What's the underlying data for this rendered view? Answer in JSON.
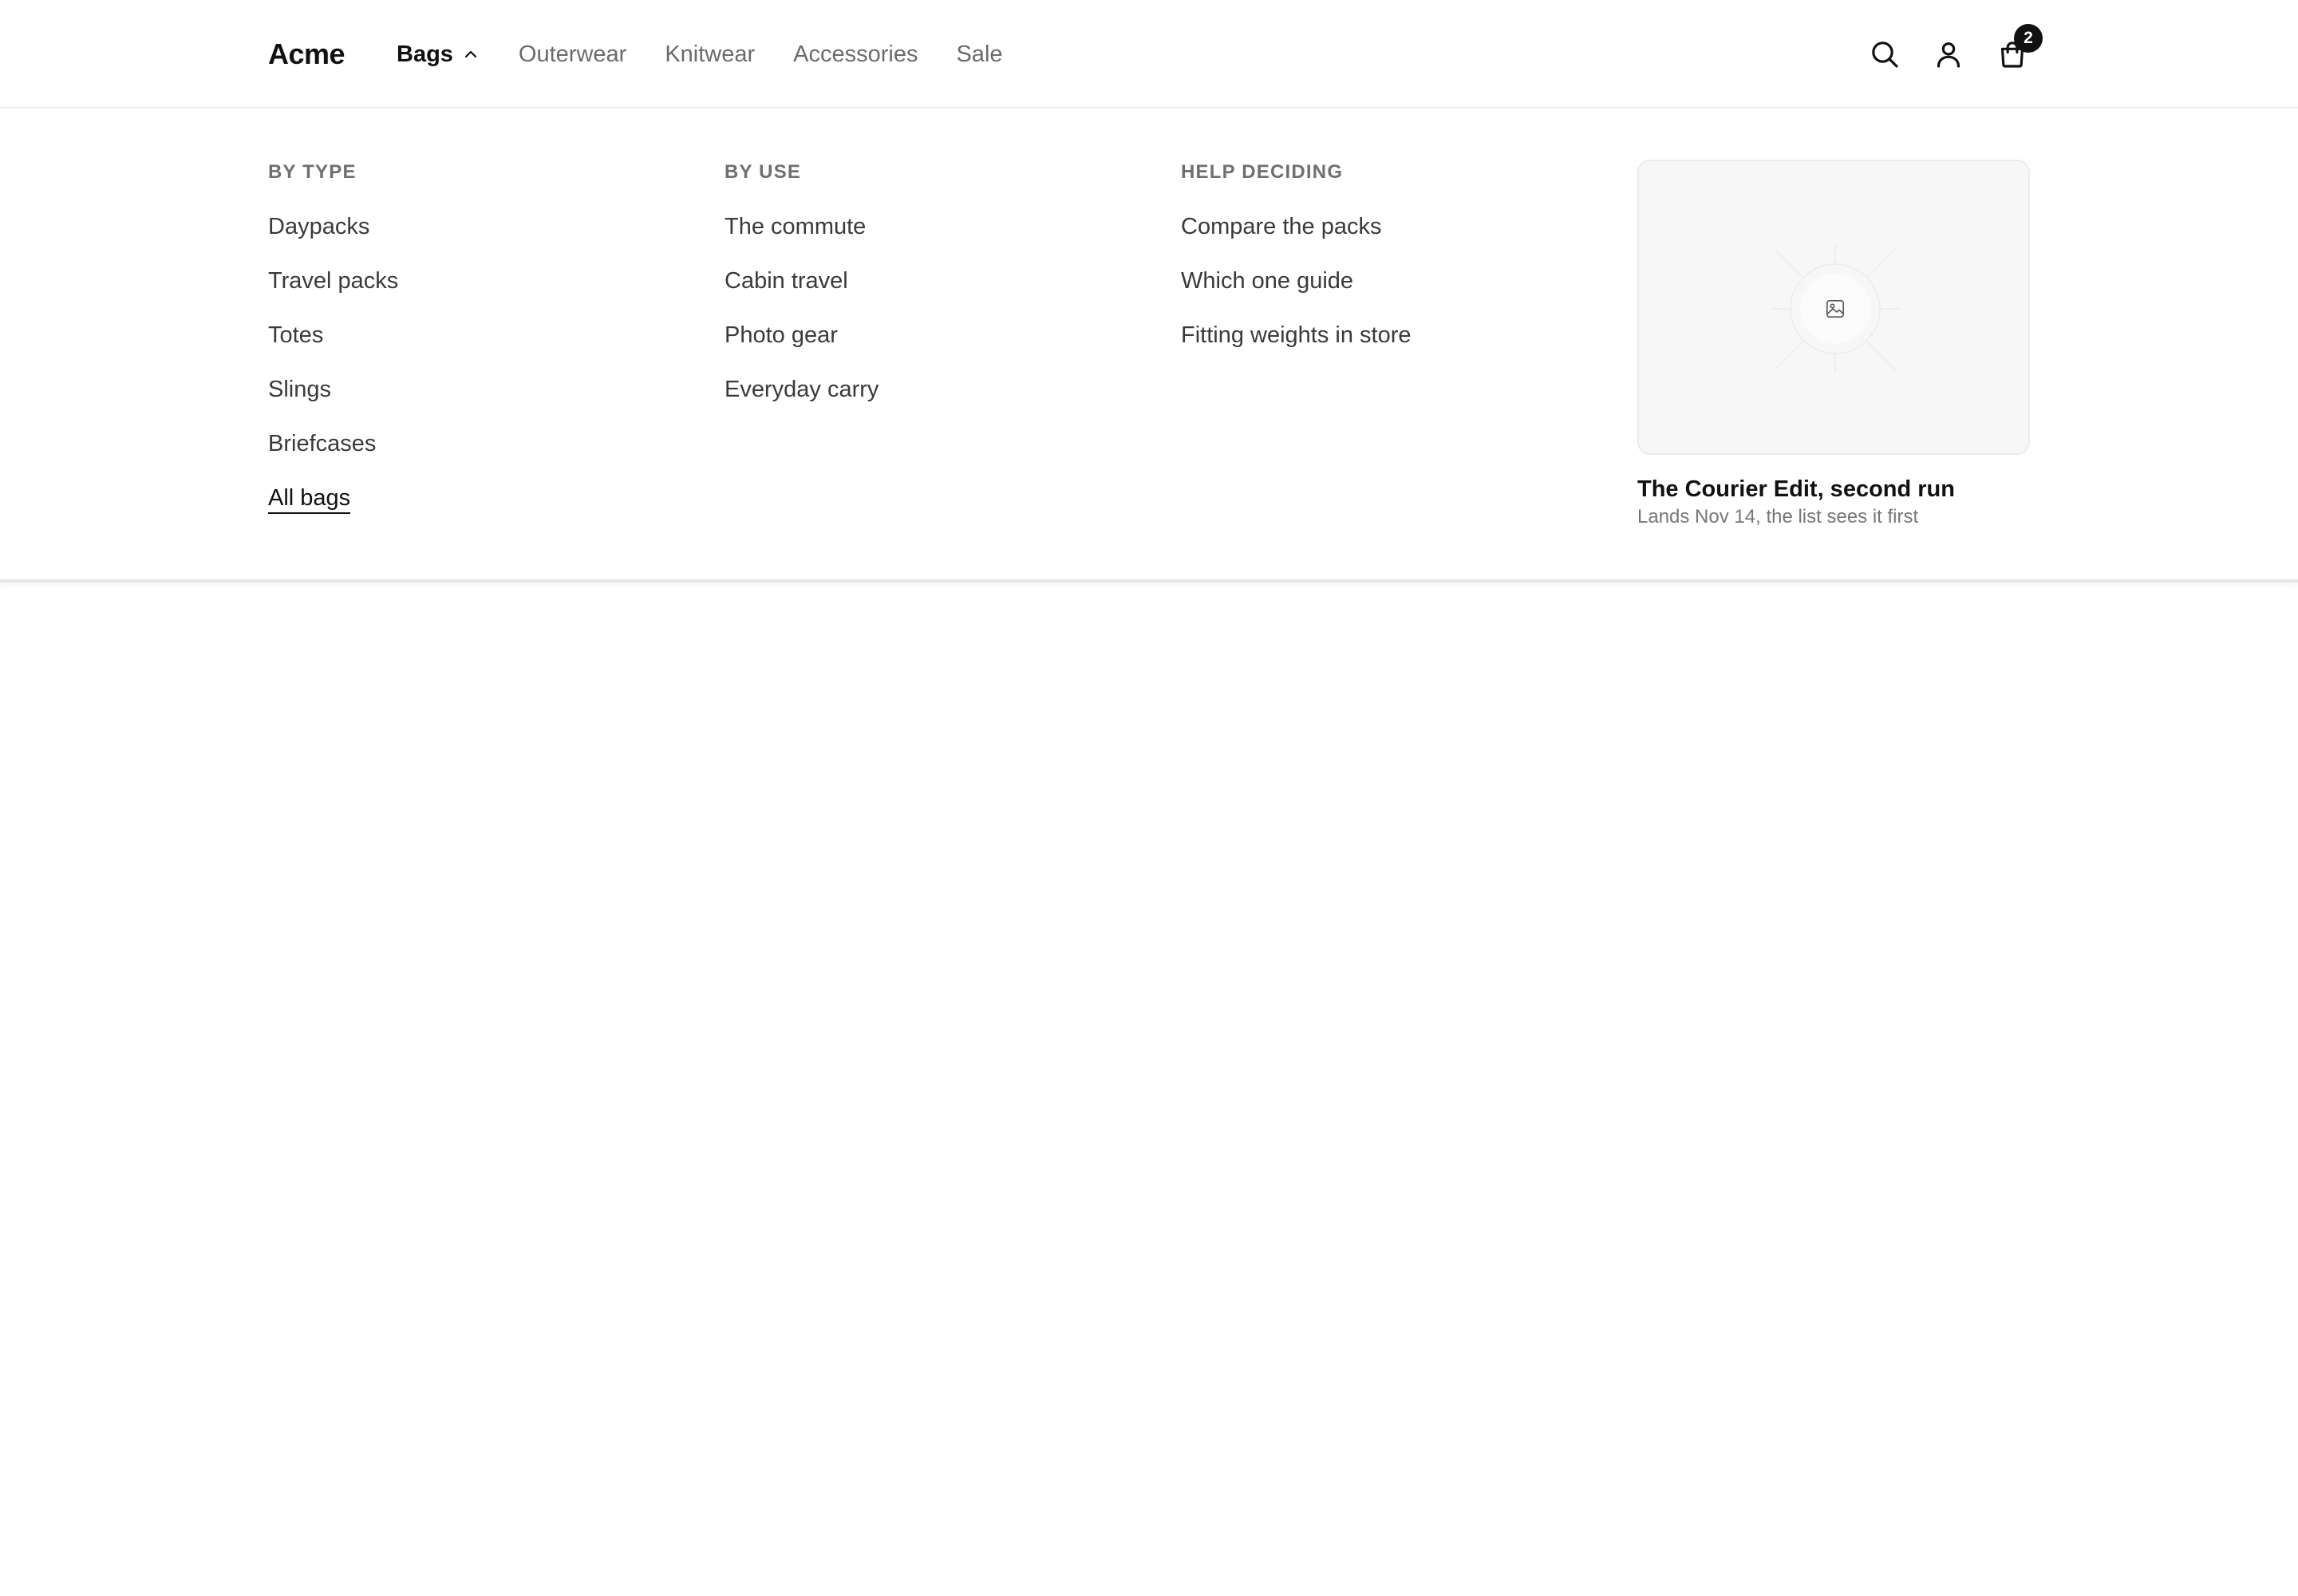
{
  "brand": {
    "logo_text": "Acme"
  },
  "nav": {
    "items": [
      {
        "label": "Bags",
        "active": true,
        "expanded": true
      },
      {
        "label": "Outerwear",
        "active": false
      },
      {
        "label": "Knitwear",
        "active": false
      },
      {
        "label": "Accessories",
        "active": false
      },
      {
        "label": "Sale",
        "active": false
      }
    ]
  },
  "header_icons": {
    "search": "search-icon",
    "account": "user-icon",
    "cart": "shopping-bag-icon",
    "cart_count": "2"
  },
  "mega_menu": {
    "columns": [
      {
        "heading": "By type",
        "links": [
          "Daypacks",
          "Travel packs",
          "Totes",
          "Slings",
          "Briefcases"
        ],
        "all_link": "All bags"
      },
      {
        "heading": "By use",
        "links": [
          "The commute",
          "Cabin travel",
          "Photo gear",
          "Everyday carry"
        ]
      },
      {
        "heading": "Help deciding",
        "links": [
          "Compare the packs",
          "Which one guide",
          "Fitting weights in store"
        ]
      }
    ],
    "feature": {
      "image_icon": "image-placeholder-icon",
      "title": "The Courier Edit, second run",
      "subtitle": "Lands Nov 14, the list sees it first"
    }
  },
  "colors": {
    "text_primary": "#111111",
    "text_muted": "#6b6b6b",
    "badge_bg": "#111111",
    "card_bg": "#f7f7f7",
    "divider": "#e6e6e6"
  }
}
